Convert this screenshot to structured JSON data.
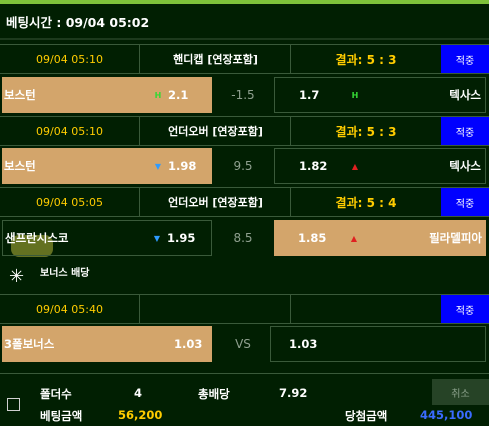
{
  "header": {
    "title": "베팅시간 : 09/04 05:02"
  },
  "bets": [
    {
      "date": "09/04 05:10",
      "type": "핸디캡 [연장포함]",
      "result": "결과: 5 : 3",
      "button": "적중",
      "home": "보스턴",
      "home_odd": "2.1",
      "home_ind": "H",
      "mid": "-1.5",
      "away": "텍사스",
      "away_odd": "1.7",
      "away_ind": "H"
    },
    {
      "date": "09/04 05:10",
      "type": "언더오버 [연장포함]",
      "result": "결과: 5 : 3",
      "button": "적중",
      "home": "보스턴",
      "home_odd": "1.98",
      "home_ind": "▼",
      "mid": "9.5",
      "away": "텍사스",
      "away_odd": "1.82",
      "away_ind": "▲"
    },
    {
      "date": "09/04 05:05",
      "type": "언더오버 [연장포함]",
      "result": "결과: 5 : 4",
      "button": "적중",
      "home": "샌프란시스코",
      "home_odd": "1.95",
      "home_ind": "▼",
      "mid": "8.5",
      "away": "필라델피아",
      "away_odd": "1.85",
      "away_ind": "▲"
    }
  ],
  "bonus": {
    "title": "보너스 배당",
    "date": "09/04 05:40",
    "button": "적중",
    "home": "3폴보너스",
    "home_odd": "1.03",
    "mid": "VS",
    "away_odd": "1.03"
  },
  "footer": {
    "folders_label": "폴더수",
    "folders_value": "4",
    "total_odds_label": "총배당",
    "total_odds_value": "7.92",
    "cancel": "취소",
    "bet_amount_label": "베팅금액",
    "bet_amount_value": "56,200",
    "win_amount_label": "당첨금액",
    "win_amount_value": "445,100"
  },
  "colors": {
    "gold": "#d3a56b",
    "blue_button": "#0000ff",
    "accent_yellow": "#ffcc00",
    "background": "#011f02"
  }
}
